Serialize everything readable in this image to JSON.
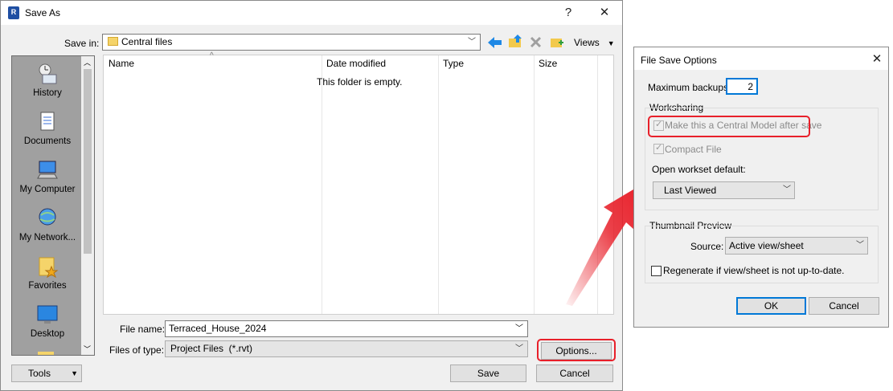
{
  "save_as": {
    "title": "Save As",
    "app_badge": "R",
    "help_glyph": "?",
    "close_glyph": "✕",
    "save_in_label": "Save in:",
    "save_in_value": "Central files",
    "views_label": "Views",
    "places": [
      {
        "label": "History",
        "icon": "history-icon"
      },
      {
        "label": "Documents",
        "icon": "documents-icon"
      },
      {
        "label": "My Computer",
        "icon": "computer-icon"
      },
      {
        "label": "My Network...",
        "icon": "network-icon"
      },
      {
        "label": "Favorites",
        "icon": "favorites-icon"
      },
      {
        "label": "Desktop",
        "icon": "desktop-icon"
      }
    ],
    "columns": [
      "Name",
      "Date modified",
      "Type",
      "Size"
    ],
    "empty_message": "This folder is empty.",
    "file_name_label": "File name:",
    "file_name_value": "Terraced_House_2024",
    "files_of_type_label": "Files of type:",
    "files_of_type_value": "Project Files  (*.rvt)",
    "options_button": "Options...",
    "tools_button": "Tools",
    "save_button": "Save",
    "cancel_button": "Cancel"
  },
  "file_save_options": {
    "title": "File Save Options",
    "close_glyph": "✕",
    "max_backups_label": "Maximum backups:",
    "max_backups_value": "2",
    "worksharing_label": "Worksharing",
    "central_model_label": "Make this a Central Model after save",
    "central_model_checked": true,
    "compact_file_label": "Compact File",
    "compact_file_checked": true,
    "open_workset_label": "Open workset default:",
    "open_workset_value": "Last Viewed",
    "thumbnail_label": "Thumbnail Preview",
    "source_label": "Source:",
    "source_value": "Active view/sheet",
    "regenerate_label": "Regenerate if view/sheet is not up-to-date.",
    "regenerate_checked": false,
    "ok_button": "OK",
    "cancel_button": "Cancel"
  },
  "colors": {
    "highlight": "#e8202a",
    "accent": "#0078d7",
    "places_bg": "#a0a0a0"
  }
}
